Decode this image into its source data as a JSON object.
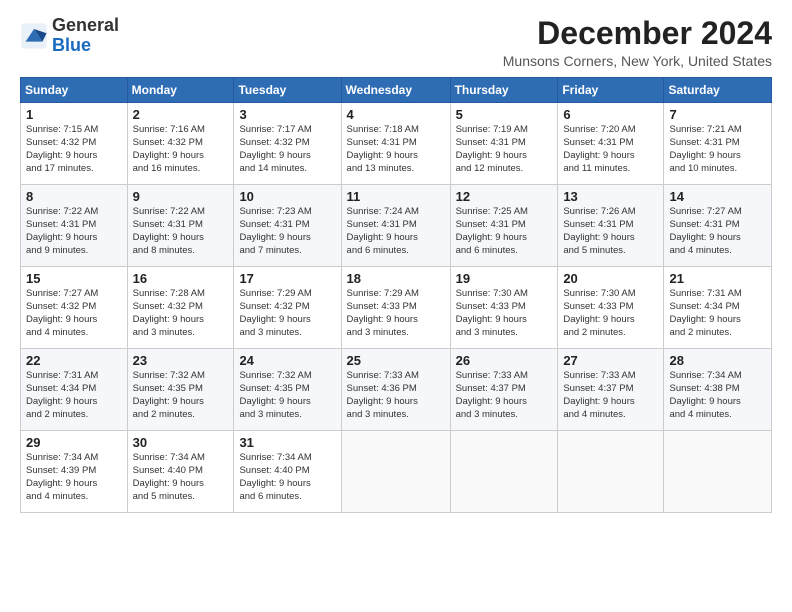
{
  "header": {
    "logo_line1": "General",
    "logo_line2": "Blue",
    "title": "December 2024",
    "subtitle": "Munsons Corners, New York, United States"
  },
  "weekdays": [
    "Sunday",
    "Monday",
    "Tuesday",
    "Wednesday",
    "Thursday",
    "Friday",
    "Saturday"
  ],
  "weeks": [
    [
      {
        "day": "1",
        "info": "Sunrise: 7:15 AM\nSunset: 4:32 PM\nDaylight: 9 hours\nand 17 minutes."
      },
      {
        "day": "2",
        "info": "Sunrise: 7:16 AM\nSunset: 4:32 PM\nDaylight: 9 hours\nand 16 minutes."
      },
      {
        "day": "3",
        "info": "Sunrise: 7:17 AM\nSunset: 4:32 PM\nDaylight: 9 hours\nand 14 minutes."
      },
      {
        "day": "4",
        "info": "Sunrise: 7:18 AM\nSunset: 4:31 PM\nDaylight: 9 hours\nand 13 minutes."
      },
      {
        "day": "5",
        "info": "Sunrise: 7:19 AM\nSunset: 4:31 PM\nDaylight: 9 hours\nand 12 minutes."
      },
      {
        "day": "6",
        "info": "Sunrise: 7:20 AM\nSunset: 4:31 PM\nDaylight: 9 hours\nand 11 minutes."
      },
      {
        "day": "7",
        "info": "Sunrise: 7:21 AM\nSunset: 4:31 PM\nDaylight: 9 hours\nand 10 minutes."
      }
    ],
    [
      {
        "day": "8",
        "info": "Sunrise: 7:22 AM\nSunset: 4:31 PM\nDaylight: 9 hours\nand 9 minutes."
      },
      {
        "day": "9",
        "info": "Sunrise: 7:22 AM\nSunset: 4:31 PM\nDaylight: 9 hours\nand 8 minutes."
      },
      {
        "day": "10",
        "info": "Sunrise: 7:23 AM\nSunset: 4:31 PM\nDaylight: 9 hours\nand 7 minutes."
      },
      {
        "day": "11",
        "info": "Sunrise: 7:24 AM\nSunset: 4:31 PM\nDaylight: 9 hours\nand 6 minutes."
      },
      {
        "day": "12",
        "info": "Sunrise: 7:25 AM\nSunset: 4:31 PM\nDaylight: 9 hours\nand 6 minutes."
      },
      {
        "day": "13",
        "info": "Sunrise: 7:26 AM\nSunset: 4:31 PM\nDaylight: 9 hours\nand 5 minutes."
      },
      {
        "day": "14",
        "info": "Sunrise: 7:27 AM\nSunset: 4:31 PM\nDaylight: 9 hours\nand 4 minutes."
      }
    ],
    [
      {
        "day": "15",
        "info": "Sunrise: 7:27 AM\nSunset: 4:32 PM\nDaylight: 9 hours\nand 4 minutes."
      },
      {
        "day": "16",
        "info": "Sunrise: 7:28 AM\nSunset: 4:32 PM\nDaylight: 9 hours\nand 3 minutes."
      },
      {
        "day": "17",
        "info": "Sunrise: 7:29 AM\nSunset: 4:32 PM\nDaylight: 9 hours\nand 3 minutes."
      },
      {
        "day": "18",
        "info": "Sunrise: 7:29 AM\nSunset: 4:33 PM\nDaylight: 9 hours\nand 3 minutes."
      },
      {
        "day": "19",
        "info": "Sunrise: 7:30 AM\nSunset: 4:33 PM\nDaylight: 9 hours\nand 3 minutes."
      },
      {
        "day": "20",
        "info": "Sunrise: 7:30 AM\nSunset: 4:33 PM\nDaylight: 9 hours\nand 2 minutes."
      },
      {
        "day": "21",
        "info": "Sunrise: 7:31 AM\nSunset: 4:34 PM\nDaylight: 9 hours\nand 2 minutes."
      }
    ],
    [
      {
        "day": "22",
        "info": "Sunrise: 7:31 AM\nSunset: 4:34 PM\nDaylight: 9 hours\nand 2 minutes."
      },
      {
        "day": "23",
        "info": "Sunrise: 7:32 AM\nSunset: 4:35 PM\nDaylight: 9 hours\nand 2 minutes."
      },
      {
        "day": "24",
        "info": "Sunrise: 7:32 AM\nSunset: 4:35 PM\nDaylight: 9 hours\nand 3 minutes."
      },
      {
        "day": "25",
        "info": "Sunrise: 7:33 AM\nSunset: 4:36 PM\nDaylight: 9 hours\nand 3 minutes."
      },
      {
        "day": "26",
        "info": "Sunrise: 7:33 AM\nSunset: 4:37 PM\nDaylight: 9 hours\nand 3 minutes."
      },
      {
        "day": "27",
        "info": "Sunrise: 7:33 AM\nSunset: 4:37 PM\nDaylight: 9 hours\nand 4 minutes."
      },
      {
        "day": "28",
        "info": "Sunrise: 7:34 AM\nSunset: 4:38 PM\nDaylight: 9 hours\nand 4 minutes."
      }
    ],
    [
      {
        "day": "29",
        "info": "Sunrise: 7:34 AM\nSunset: 4:39 PM\nDaylight: 9 hours\nand 4 minutes."
      },
      {
        "day": "30",
        "info": "Sunrise: 7:34 AM\nSunset: 4:40 PM\nDaylight: 9 hours\nand 5 minutes."
      },
      {
        "day": "31",
        "info": "Sunrise: 7:34 AM\nSunset: 4:40 PM\nDaylight: 9 hours\nand 6 minutes."
      },
      null,
      null,
      null,
      null
    ]
  ]
}
